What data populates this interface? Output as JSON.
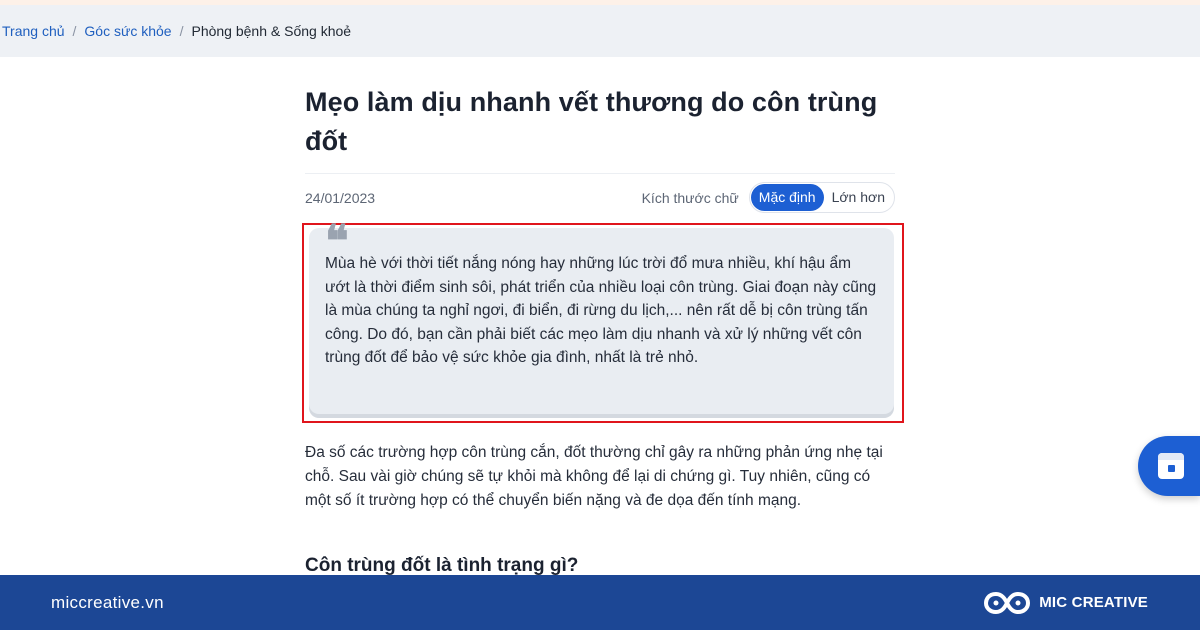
{
  "breadcrumb": {
    "items": [
      "Trang chủ",
      "Góc sức khỏe"
    ],
    "separator": "/",
    "current": "Phòng bệnh & Sống khoẻ"
  },
  "article": {
    "title": "Mẹo làm dịu nhanh vết thương do côn trùng đốt",
    "date": "24/01/2023",
    "font_size_label": "Kích thước chữ",
    "font_size_options": [
      "Mặc định",
      "Lớn hơn"
    ],
    "font_size_selected": "Mặc định",
    "quote_mark": "❝",
    "quote": "Mùa hè với thời tiết nắng nóng hay những lúc trời đổ mưa nhiều, khí hậu ẩm ướt là thời điểm sinh sôi, phát triển của nhiều loại côn trùng. Giai đoạn này cũng là mùa chúng ta nghỉ ngơi, đi biển, đi rừng du lịch,... nên rất dễ bị côn trùng tấn công. Do đó, bạn cần phải biết các mẹo làm dịu nhanh và xử lý những vết côn trùng đốt để bảo vệ sức khỏe gia đình, nhất là trẻ nhỏ.",
    "paragraph": "Đa số các trường hợp côn trùng cắn, đốt thường chỉ gây ra những phản ứng nhẹ tại chỗ. Sau vài giờ chúng sẽ tự khỏi mà không để lại di chứng gì. Tuy nhiên, cũng có một số ít trường hợp có thể chuyển biến nặng và đe dọa đến tính mạng.",
    "subheading": "Côn trùng đốt là tình trạng gì?"
  },
  "footer": {
    "domain": "miccreative.vn",
    "brand": "MIC CREATIVE"
  },
  "colors": {
    "accent": "#1d5fd3",
    "footer": "#1c4795",
    "highlight_outline": "#e0151c",
    "quote_bg": "#e9edf2"
  },
  "icons": {
    "floating_widget": "calendar-icon",
    "brand_logo": "infinity-logo-icon"
  }
}
